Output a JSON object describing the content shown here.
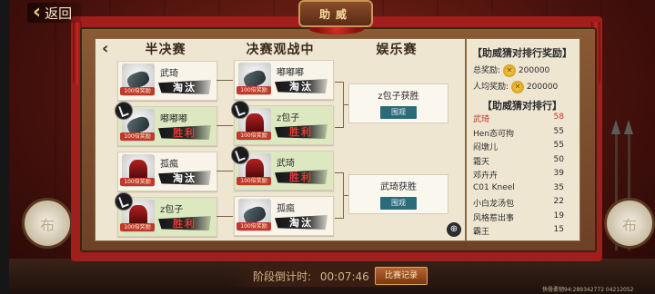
{
  "header": {
    "back_label": "返回",
    "title": "助威"
  },
  "columns": {
    "semi": "半决赛",
    "final": "决赛观战中",
    "fun": "娱乐赛"
  },
  "semi_cards": [
    {
      "name": "武琦",
      "stamp": "淘汰",
      "badge": "100倍奖励",
      "result": "lose",
      "avatar": "grey"
    },
    {
      "name": "嘟嘟嘟",
      "stamp": "胜利",
      "badge": "100倍奖励",
      "result": "win",
      "avatar": "grey"
    },
    {
      "name": "孤瘋",
      "stamp": "淘汰",
      "badge": "100倍奖励",
      "result": "lose",
      "avatar": "red"
    },
    {
      "name": "z包子",
      "stamp": "胜利",
      "badge": "100倍奖励",
      "result": "win",
      "avatar": "red"
    }
  ],
  "final_cards": [
    {
      "name": "嘟嘟嘟",
      "stamp": "淘汰",
      "badge": "100倍奖励",
      "result": "lose",
      "avatar": "grey"
    },
    {
      "name": "z包子",
      "stamp": "胜利",
      "badge": "100倍奖励",
      "result": "win",
      "avatar": "red"
    },
    {
      "name": "武琦",
      "stamp": "胜利",
      "badge": "100倍奖励",
      "result": "win",
      "avatar": "red"
    },
    {
      "name": "孤瘋",
      "stamp": "淘汰",
      "badge": "100倍奖励",
      "result": "lose",
      "avatar": "grey"
    }
  ],
  "entertainment": [
    {
      "text": "z包子获胜",
      "button": "围观"
    },
    {
      "text": "武琦获胜",
      "button": "围观"
    }
  ],
  "rewards": {
    "title": "【助威猜对排行奖励】",
    "total_label": "总奖励:",
    "total_value": "200000",
    "per_label": "人均奖励:",
    "per_value": "200000"
  },
  "ranking": {
    "title": "【助威猜对排行】",
    "rows": [
      {
        "name": "武琦",
        "score": "58"
      },
      {
        "name": "Hen态可拘",
        "score": "55"
      },
      {
        "name": "闷墩儿",
        "score": "55"
      },
      {
        "name": "霜天",
        "score": "50"
      },
      {
        "name": "邓卉卉",
        "score": "39"
      },
      {
        "name": "C01 Kneel",
        "score": "35"
      },
      {
        "name": "小白龙汤包",
        "score": "22"
      },
      {
        "name": "风格惹出事",
        "score": "19"
      },
      {
        "name": "霸王",
        "score": "15"
      }
    ]
  },
  "footer": {
    "countdown_label": "阶段倒计时:",
    "countdown_value": "00:07:46",
    "record_button": "比赛记录"
  },
  "watermark": "快骨柔韧94:289342772 04212052",
  "drum_char": "布",
  "colors": {
    "accent_red": "#c0392b",
    "win_bg": "#dce8c0",
    "button_teal": "#2b6b7a"
  }
}
